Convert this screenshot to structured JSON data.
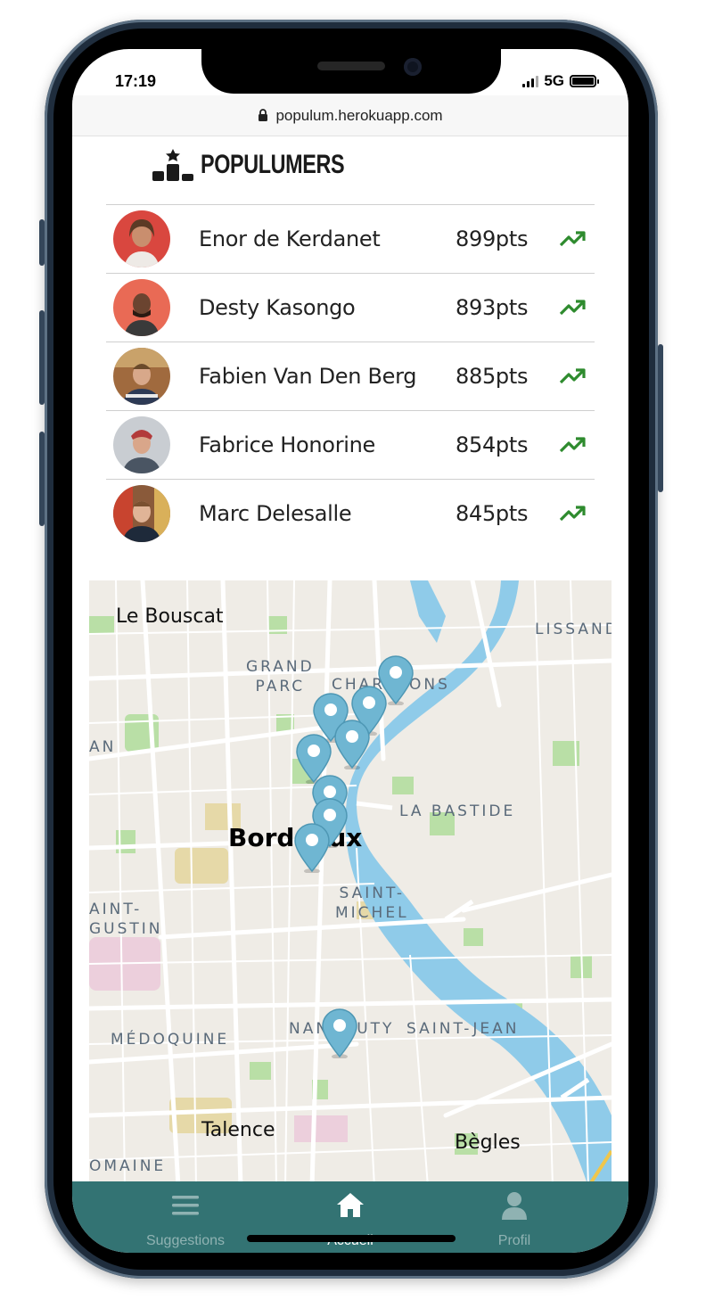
{
  "status_bar": {
    "time": "17:19",
    "network": "5G"
  },
  "browser": {
    "url": "populum.herokuapp.com",
    "lock_icon": "lock-icon"
  },
  "header": {
    "title": "POPULUMERS",
    "icon": "podium-icon"
  },
  "leaderboard": [
    {
      "name": "Enor de Kerdanet",
      "points": "899pts",
      "trend_icon": "trending-up-icon",
      "avatar_bg": "#d9473f"
    },
    {
      "name": "Desty Kasongo",
      "points": "893pts",
      "trend_icon": "trending-up-icon",
      "avatar_bg": "#e96a55"
    },
    {
      "name": "Fabien Van Den Berg",
      "points": "885pts",
      "trend_icon": "trending-up-icon",
      "avatar_bg": "#a06a3e"
    },
    {
      "name": "Fabrice Honorine",
      "points": "854pts",
      "trend_icon": "trending-up-icon",
      "avatar_bg": "#c9cdd2"
    },
    {
      "name": "Marc Delesalle",
      "points": "845pts",
      "trend_icon": "trending-up-icon",
      "avatar_bg": "#8a5a3a"
    }
  ],
  "map": {
    "labels": {
      "le_bouscat": "Le Bouscat",
      "lissandre": "LISSAND",
      "grand_parc": "GRAND\nPARC",
      "chartrons": "CHARTRONS",
      "an": "AN",
      "la_bastide": "LA BASTIDE",
      "bordeaux": "Bordeaux",
      "saint_michel": "SAINT-\nMICHEL",
      "saint_augustin": "AINT-\nGUSTIN",
      "medoquine": "MÉDOQUINE",
      "nansouty": "NANSOUTY",
      "saint_jean": "SAINT-JEAN",
      "talence": "Talence",
      "begles": "Bègles",
      "domaine": "OMAINE"
    },
    "pin_count": 9
  },
  "bottom_nav": {
    "items": [
      {
        "label": "Suggestions",
        "icon": "menu-icon",
        "active": false
      },
      {
        "label": "Accueil",
        "icon": "home-icon",
        "active": true
      },
      {
        "label": "Profil",
        "icon": "user-icon",
        "active": false
      }
    ]
  },
  "colors": {
    "accent": "#337373",
    "trend": "#2e8b2e",
    "pin": "#6fb6d2",
    "river": "#8fcbe9"
  }
}
